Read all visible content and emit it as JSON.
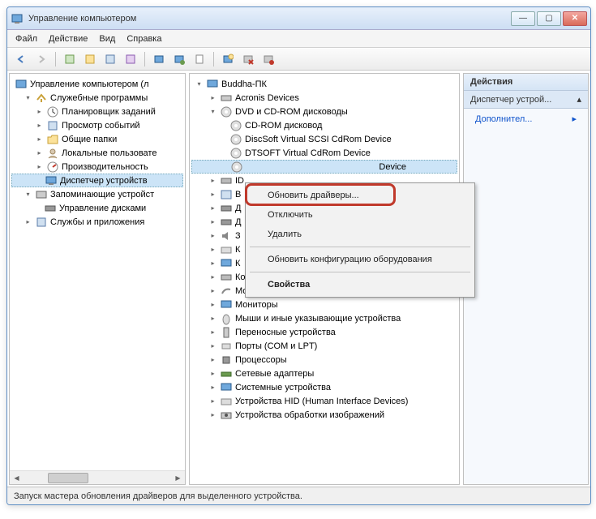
{
  "window": {
    "title": "Управление компьютером"
  },
  "menu": {
    "file": "Файл",
    "action": "Действие",
    "view": "Вид",
    "help": "Справка"
  },
  "left_tree": {
    "root": "Управление компьютером (л",
    "system_tools": "Служебные программы",
    "scheduler": "Планировщик заданий",
    "event_viewer": "Просмотр событий",
    "shared_folders": "Общие папки",
    "local_users": "Локальные пользовате",
    "performance": "Производительность",
    "device_manager": "Диспетчер устройств",
    "storage": "Запоминающие устройст",
    "disk_mgmt": "Управление дисками",
    "services_apps": "Службы и приложения"
  },
  "mid_tree": {
    "root": "Buddha-ПК",
    "acronis": "Acronis Devices",
    "dvd": "DVD и CD-ROM дисководы",
    "cdrom": "CD-ROM дисковод",
    "discsoft": "DiscSoft Virtual SCSI CdRom Device",
    "dtsoft": "DTSOFT Virtual CdRom Device",
    "selected_partial": "Device",
    "ide": "ID",
    "category_b": "В",
    "disk": "Д",
    "disk2": "Д",
    "sound": "З",
    "keyboards": "К",
    "computer": "К",
    "controllers": "Контроллеры запоминающих устройств",
    "modems": "Модемы",
    "monitors": "Мониторы",
    "mice": "Мыши и иные указывающие устройства",
    "portable": "Переносные устройства",
    "ports": "Порты (COM и LPT)",
    "processors": "Процессоры",
    "network": "Сетевые адаптеры",
    "system": "Системные устройства",
    "hid": "Устройства HID (Human Interface Devices)",
    "imaging": "Устройства обработки изображений"
  },
  "context": {
    "update": "Обновить драйверы...",
    "disable": "Отключить",
    "delete": "Удалить",
    "scan": "Обновить конфигурацию оборудования",
    "props": "Свойства"
  },
  "right": {
    "header": "Действия",
    "sub": "Диспетчер устрой...",
    "more": "Дополнител..."
  },
  "status": "Запуск мастера обновления драйверов для выделенного устройства."
}
